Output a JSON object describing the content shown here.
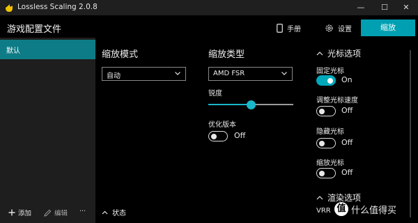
{
  "window": {
    "title": "Lossless Scaling 2.0.8",
    "controls": [
      "—",
      "☐",
      "✕"
    ]
  },
  "header": {
    "profile_title": "游戏配置文件",
    "manual_label": "手册",
    "settings_label": "设置",
    "scale_button": "缩放"
  },
  "sidebar": {
    "profiles": [
      {
        "label": "默认",
        "selected": true
      }
    ],
    "add_label": "添加",
    "edit_label": "编辑",
    "more_label": "···",
    "status_label": "状态"
  },
  "scaling_mode": {
    "title": "缩放模式",
    "value": "自动"
  },
  "scaling_type": {
    "title": "缩放类型",
    "value": "AMD FSR",
    "sharpness_label": "锐度",
    "sharpness_fraction": 0.5,
    "optimized_label": "优化版本",
    "optimized_state": "Off"
  },
  "cursor": {
    "section_title": "光标选项",
    "clip_label": "固定光标",
    "clip_state": "On",
    "adjust_speed_label": "调整光标速度",
    "adjust_speed_state": "Off",
    "hide_label": "隐藏光标",
    "hide_state": "Off",
    "scale_label": "缩放光标",
    "scale_state": "Off"
  },
  "render": {
    "section_title": "渲染选项",
    "vrr_label": "VRR"
  },
  "watermark": {
    "symbol": "值",
    "text": "什么值得买"
  },
  "colors": {
    "accent": "#00a0b2",
    "selected_profile": "#0e7c86",
    "sidebar_bg": "#1e1e1e",
    "titlebar_bg": "#1f1f1f"
  }
}
